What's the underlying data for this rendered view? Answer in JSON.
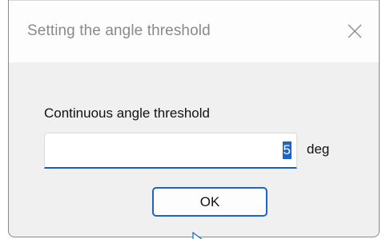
{
  "dialog": {
    "title": "Setting the angle threshold",
    "close_icon": "close-icon",
    "label": "Continuous angle threshold",
    "input_value": "5",
    "unit": "deg",
    "ok_label": "OK"
  },
  "colors": {
    "accent": "#1a66c8",
    "title_text": "#8a8a8a",
    "dialog_bg": "#f0f0f0"
  }
}
